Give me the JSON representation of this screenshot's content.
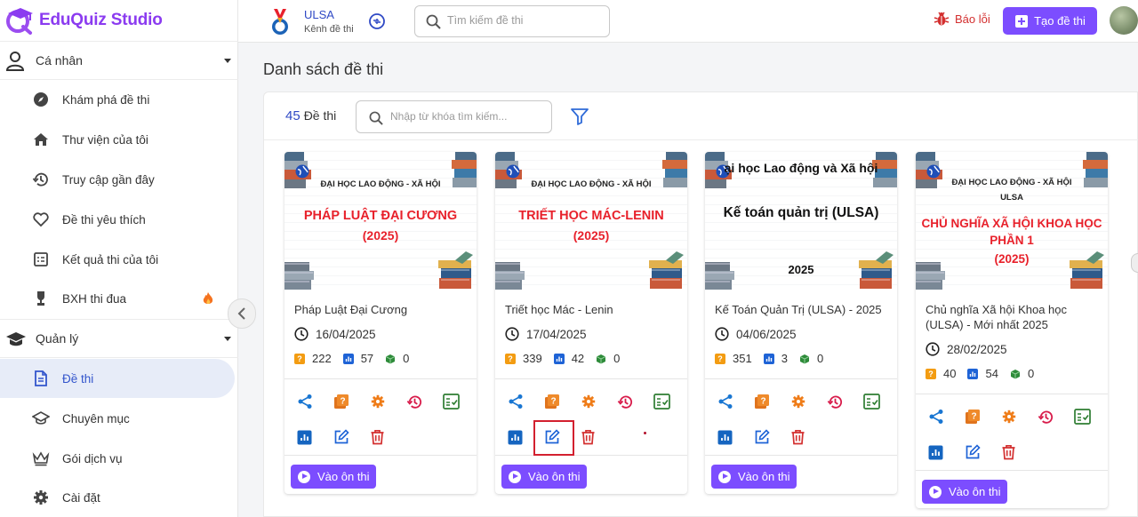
{
  "app": {
    "name": "EduQuiz Studio"
  },
  "sidebar": {
    "personal": {
      "label": "Cá nhân"
    },
    "personal_items": [
      {
        "label": "Khám phá đề thi",
        "icon": "compass-icon"
      },
      {
        "label": "Thư viện của tôi",
        "icon": "home-icon"
      },
      {
        "label": "Truy cập gần đây",
        "icon": "history-icon"
      },
      {
        "label": "Đề thi yêu thích",
        "icon": "heart-icon"
      },
      {
        "label": "Kết quả thi của tôi",
        "icon": "results-icon"
      },
      {
        "label": "BXH thi đua",
        "icon": "trophy-icon"
      }
    ],
    "manage": {
      "label": "Quản lý"
    },
    "manage_items": [
      {
        "label": "Đề thi",
        "icon": "document-icon",
        "active": true
      },
      {
        "label": "Chuyên mục",
        "icon": "category-icon"
      },
      {
        "label": "Gói dịch vụ",
        "icon": "crown-icon"
      },
      {
        "label": "Cài đặt",
        "icon": "gear-icon"
      }
    ]
  },
  "header": {
    "channel_name": "ULSA",
    "channel_sub": "Kênh đề thi",
    "search_placeholder": "Tìm kiếm đề thi",
    "report_label": "Báo lỗi",
    "create_label": "Tạo đề thi"
  },
  "main": {
    "title": "Danh sách đề thi",
    "count": "45",
    "count_label": "Đề thi",
    "search_placeholder": "Nhập từ khóa tìm kiếm..."
  },
  "cards": [
    {
      "thumb_lines": [
        "ĐẠI HỌC LAO ĐỘNG - XÃ HỘI",
        "PHÁP LUẬT ĐẠI CƯƠNG",
        "(2025)"
      ],
      "name": "Pháp Luật Đại Cương",
      "date": "16/04/2025",
      "questions": "222",
      "views": "57",
      "downloads": "0",
      "action_label": "Vào ôn thi"
    },
    {
      "thumb_lines": [
        "ĐẠI HỌC LAO ĐỘNG - XÃ HỘI",
        "TRIẾT HỌC MÁC-LENIN",
        "(2025)"
      ],
      "name": "Triết học Mác - Lenin",
      "date": "17/04/2025",
      "questions": "339",
      "views": "42",
      "downloads": "0",
      "action_label": "Vào ôn thi"
    },
    {
      "thumb_lines": [
        "ại học Lao động và Xã hội",
        "Kế toán quản trị (ULSA)",
        "2025"
      ],
      "name": "Kế Toán Quản Trị (ULSA) - 2025",
      "date": "04/06/2025",
      "questions": "351",
      "views": "3",
      "downloads": "0",
      "action_label": "Vào ôn thi"
    },
    {
      "thumb_lines": [
        "ĐẠI HỌC LAO ĐỘNG - XÃ HỘI",
        "ULSA",
        "CHỦ NGHĨA XÃ HỘI KHOA HỌC",
        "PHẦN 1",
        "(2025)"
      ],
      "name": "Chủ nghĩa Xã hội Khoa học (ULSA) - Mới nhất 2025",
      "date": "28/02/2025",
      "questions": "40",
      "views": "54",
      "downloads": "0",
      "action_label": "Vào ôn thi"
    }
  ],
  "colors": {
    "accent": "#7c4dff",
    "active_bg": "#e7ecf8",
    "blue": "#2f49c5",
    "danger": "#d32f2f",
    "thumb_red": "#e8212b"
  }
}
